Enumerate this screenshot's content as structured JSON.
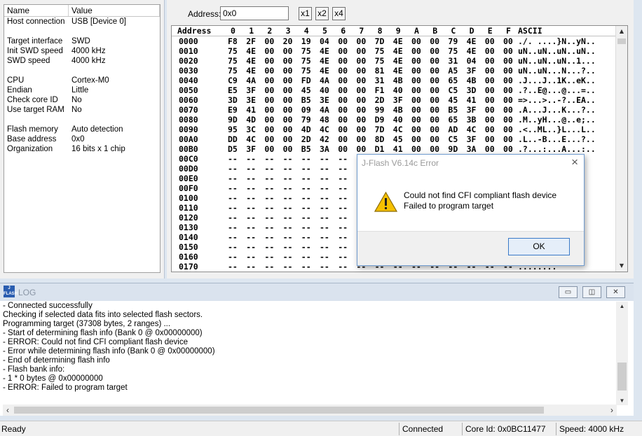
{
  "properties": {
    "headers": {
      "name": "Name",
      "value": "Value"
    },
    "groups": [
      [
        {
          "k": "Host connection",
          "v": "USB [Device 0]"
        }
      ],
      [
        {
          "k": "Target interface",
          "v": "SWD"
        },
        {
          "k": "Init SWD speed",
          "v": "4000 kHz"
        },
        {
          "k": "SWD speed",
          "v": "4000 kHz"
        }
      ],
      [
        {
          "k": "CPU",
          "v": "Cortex-M0"
        },
        {
          "k": "Endian",
          "v": "Little"
        },
        {
          "k": "Check core ID",
          "v": "No"
        },
        {
          "k": "Use target RAM",
          "v": "No"
        }
      ],
      [
        {
          "k": "Flash memory",
          "v": "Auto detection"
        },
        {
          "k": "Base address",
          "v": "0x0"
        },
        {
          "k": "Organization",
          "v": "16 bits x 1 chip"
        }
      ]
    ]
  },
  "memory": {
    "address_label": "Address:",
    "address_value": "0x0",
    "zoom_buttons": [
      "x1",
      "x2",
      "x4"
    ],
    "columns": [
      "Address",
      "0",
      "1",
      "2",
      "3",
      "4",
      "5",
      "6",
      "7",
      "8",
      "9",
      "A",
      "B",
      "C",
      "D",
      "E",
      "F",
      "ASCII"
    ],
    "rows": [
      {
        "addr": "0000",
        "bytes": [
          "F8",
          "2F",
          "00",
          "20",
          "19",
          "04",
          "00",
          "00",
          "7D",
          "4E",
          "00",
          "00",
          "79",
          "4E",
          "00",
          "00"
        ],
        "ascii": "./. ....}N..yN.."
      },
      {
        "addr": "0010",
        "bytes": [
          "75",
          "4E",
          "00",
          "00",
          "75",
          "4E",
          "00",
          "00",
          "75",
          "4E",
          "00",
          "00",
          "75",
          "4E",
          "00",
          "00"
        ],
        "ascii": "uN..uN..uN..uN.."
      },
      {
        "addr": "0020",
        "bytes": [
          "75",
          "4E",
          "00",
          "00",
          "75",
          "4E",
          "00",
          "00",
          "75",
          "4E",
          "00",
          "00",
          "31",
          "04",
          "00",
          "00"
        ],
        "ascii": "uN..uN..uN..1..."
      },
      {
        "addr": "0030",
        "bytes": [
          "75",
          "4E",
          "00",
          "00",
          "75",
          "4E",
          "00",
          "00",
          "81",
          "4E",
          "00",
          "00",
          "A5",
          "3F",
          "00",
          "00"
        ],
        "ascii": "uN..uN...N...?.."
      },
      {
        "addr": "0040",
        "bytes": [
          "C9",
          "4A",
          "00",
          "00",
          "FD",
          "4A",
          "00",
          "00",
          "31",
          "4B",
          "00",
          "00",
          "65",
          "4B",
          "00",
          "00"
        ],
        "ascii": ".J...J..1K..eK.."
      },
      {
        "addr": "0050",
        "bytes": [
          "E5",
          "3F",
          "00",
          "00",
          "45",
          "40",
          "00",
          "00",
          "F1",
          "40",
          "00",
          "00",
          "C5",
          "3D",
          "00",
          "00"
        ],
        "ascii": ".?..E@...@...=.."
      },
      {
        "addr": "0060",
        "bytes": [
          "3D",
          "3E",
          "00",
          "00",
          "B5",
          "3E",
          "00",
          "00",
          "2D",
          "3F",
          "00",
          "00",
          "45",
          "41",
          "00",
          "00"
        ],
        "ascii": "=>...>..-?..EA.."
      },
      {
        "addr": "0070",
        "bytes": [
          "E9",
          "41",
          "00",
          "00",
          "09",
          "4A",
          "00",
          "00",
          "99",
          "4B",
          "00",
          "00",
          "B5",
          "3F",
          "00",
          "00"
        ],
        "ascii": ".A...J...K...?.."
      },
      {
        "addr": "0080",
        "bytes": [
          "9D",
          "4D",
          "00",
          "00",
          "79",
          "48",
          "00",
          "00",
          "D9",
          "40",
          "00",
          "00",
          "65",
          "3B",
          "00",
          "00"
        ],
        "ascii": ".M..yH...@..e;.."
      },
      {
        "addr": "0090",
        "bytes": [
          "95",
          "3C",
          "00",
          "00",
          "4D",
          "4C",
          "00",
          "00",
          "7D",
          "4C",
          "00",
          "00",
          "AD",
          "4C",
          "00",
          "00"
        ],
        "ascii": ".<..ML..}L...L.."
      },
      {
        "addr": "00A0",
        "bytes": [
          "DD",
          "4C",
          "00",
          "00",
          "2D",
          "42",
          "00",
          "00",
          "8D",
          "45",
          "00",
          "00",
          "C5",
          "3F",
          "00",
          "00"
        ],
        "ascii": ".L..-B...E...?.."
      },
      {
        "addr": "00B0",
        "bytes": [
          "D5",
          "3F",
          "00",
          "00",
          "B5",
          "3A",
          "00",
          "00",
          "D1",
          "41",
          "00",
          "00",
          "9D",
          "3A",
          "00",
          "00"
        ],
        "ascii": ".?...:...A...:.."
      },
      {
        "addr": "00C0",
        "empty": true
      },
      {
        "addr": "00D0",
        "empty": true
      },
      {
        "addr": "00E0",
        "empty": true
      },
      {
        "addr": "00F0",
        "empty": true
      },
      {
        "addr": "0100",
        "empty": true
      },
      {
        "addr": "0110",
        "empty": true
      },
      {
        "addr": "0120",
        "empty": true
      },
      {
        "addr": "0130",
        "empty": true
      },
      {
        "addr": "0140",
        "empty": true
      },
      {
        "addr": "0150",
        "empty": true
      },
      {
        "addr": "0160",
        "empty": true
      },
      {
        "addr": "0170",
        "empty": true
      }
    ],
    "empty_byte": "--",
    "empty_ascii": "........"
  },
  "dialog": {
    "title": "J-Flash V6.14c Error",
    "close": "×",
    "line1": "Could not find CFI compliant flash device",
    "line2": "Failed to program target",
    "ok": "OK"
  },
  "log": {
    "title": "LOG",
    "lines": [
      " - Connected successfully",
      "Checking if selected data fits into selected flash sectors.",
      "Programming target (37308 bytes, 2 ranges) ...",
      " - Start of determining flash info (Bank 0 @ 0x00000000)",
      " - ERROR: Could not find CFI compliant flash device",
      " - Error while determining flash info (Bank 0 @ 0x00000000)",
      " - End of determining flash info",
      " - Flash bank info:",
      " - 1 * 0 bytes @ 0x00000000",
      " - ERROR: Failed to program target"
    ]
  },
  "status": {
    "ready": "Ready",
    "connected": "Connected",
    "core_id": "Core Id: 0x0BC11477",
    "speed": "Speed: 4000 kHz"
  },
  "colors": {
    "accent": "#2a5db0",
    "warning": "#f5c000"
  }
}
